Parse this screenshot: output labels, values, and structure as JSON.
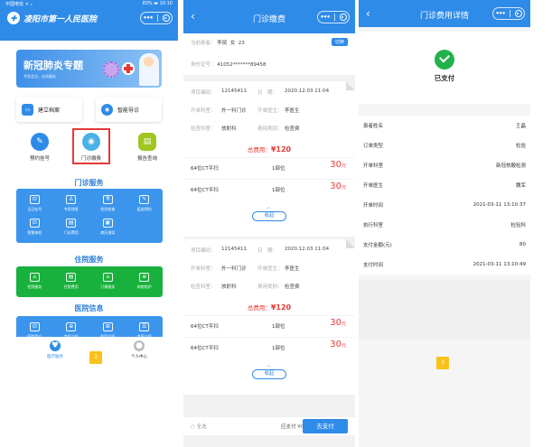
{
  "p1": {
    "status_left": "中国电信 ᯤ ᵢₗ",
    "status_right": "83% ▬ 10:10",
    "hospital_name": "凌阳市第一人民医院",
    "banner_title": "新冠肺炎专题",
    "banner_sub": "专家会诊，在线服务",
    "quick": [
      {
        "label": "建立档案",
        "icon": "archive-icon",
        "color": "#2f8be8"
      },
      {
        "label": "智能导诊",
        "icon": "guide-icon",
        "color": "#2f8be8"
      }
    ],
    "round": [
      {
        "label": "预约挂号",
        "icon": "syringe-icon",
        "color": "#2f8be8"
      },
      {
        "label": "门诊缴费",
        "icon": "payment-icon",
        "color": "#4ab0e8"
      },
      {
        "label": "报告查询",
        "icon": "report-icon",
        "color": "#9fc621"
      }
    ],
    "sec_outpatient": "门诊服务",
    "outpatient": [
      {
        "label": "当日挂号",
        "glyph": "⊡"
      },
      {
        "label": "专家排班",
        "glyph": "♙"
      },
      {
        "label": "检验检查",
        "glyph": "⚗"
      },
      {
        "label": "疫苗预约",
        "glyph": "✎"
      },
      {
        "label": "智慧体检",
        "glyph": "⊡"
      },
      {
        "label": "门诊费用",
        "glyph": "▤"
      },
      {
        "label": "病历指导",
        "glyph": "▣"
      }
    ],
    "sec_inpatient": "住院服务",
    "inpatient": [
      {
        "label": "住院服务",
        "glyph": "⌂"
      },
      {
        "label": "住院费用",
        "glyph": "▤"
      },
      {
        "label": "订餐服务",
        "glyph": "⌂"
      },
      {
        "label": "病房陪护",
        "glyph": "⊕"
      }
    ],
    "sec_info": "医院信息",
    "info": [
      {
        "label": "医院简介",
        "glyph": "⊡"
      },
      {
        "label": "专科介绍",
        "glyph": "⊕"
      },
      {
        "label": "科室介绍",
        "glyph": "⊞"
      },
      {
        "label": "专家介绍",
        "glyph": "☰"
      }
    ],
    "tab_service": "医疗服务",
    "tab_me": "个人中心",
    "marker": "1"
  },
  "p2": {
    "title": "门诊缴费",
    "patient": {
      "k": "当前患者：",
      "name": "李丽",
      "sex": "女",
      "age": "23"
    },
    "switch": "切换",
    "id": {
      "k": "身份证号：",
      "v": "41052*******89458"
    },
    "orders": [
      {
        "no_k": "项目编码：",
        "no": "12145411",
        "date_k": "日　期：",
        "date": "2020.12.03 11:04",
        "dept_k": "开单科室：",
        "dept": "外一科门诊",
        "doc_k": "开单医生：",
        "doc": "李医生",
        "exam_k": "检查科室：",
        "exam": "放射科",
        "fee_k": "费用类别：",
        "fee": "检查费",
        "total_k": "总费用：",
        "total": "¥120",
        "items": [
          {
            "name": "64位CT平扫",
            "count": "1部位",
            "price": "30",
            "unit": "元"
          },
          {
            "name": "64位CT平扫",
            "count": "1部位",
            "price": "30",
            "unit": "元"
          }
        ],
        "collapse": "收起"
      },
      {
        "no_k": "项目编码：",
        "no": "12145411",
        "date_k": "日　期：",
        "date": "2020.12.03 11:04",
        "dept_k": "开单科室：",
        "dept": "外一科门诊",
        "doc_k": "开单医生：",
        "doc": "李医生",
        "exam_k": "检查科室：",
        "exam": "放射科",
        "fee_k": "费用类别：",
        "fee": "检查费",
        "total_k": "总费用：",
        "total": "¥120",
        "items": [
          {
            "name": "64位CT平扫",
            "count": "1部位",
            "price": "30",
            "unit": "元"
          },
          {
            "name": "64位CT平扫",
            "count": "1部位",
            "price": "30",
            "unit": "元"
          }
        ],
        "collapse": "收起"
      }
    ],
    "select_all": "全选",
    "pay_due": "应支付 ¥0.00",
    "pay_btn": "去支付"
  },
  "p3": {
    "title": "门诊费用详情",
    "paid": "已支付",
    "details": [
      {
        "k": "患者姓名",
        "v": "王晶"
      },
      {
        "k": "订单类型",
        "v": "检验"
      },
      {
        "k": "开单科室",
        "v": "新冠核酸检测"
      },
      {
        "k": "开单医生",
        "v": "魏军"
      },
      {
        "k": "开单时间",
        "v": "2021-03-11 13:10:37"
      },
      {
        "k": "执行科室",
        "v": "检验科"
      },
      {
        "k": "支付金额(元)",
        "v": "80"
      },
      {
        "k": "支付时间",
        "v": "2021-03-11 13:10:49"
      }
    ],
    "marker": "3"
  },
  "colors": {
    "primary": "#2f8be8",
    "green": "#19b13d",
    "red": "#e53935",
    "marker": "#f8c21b"
  }
}
